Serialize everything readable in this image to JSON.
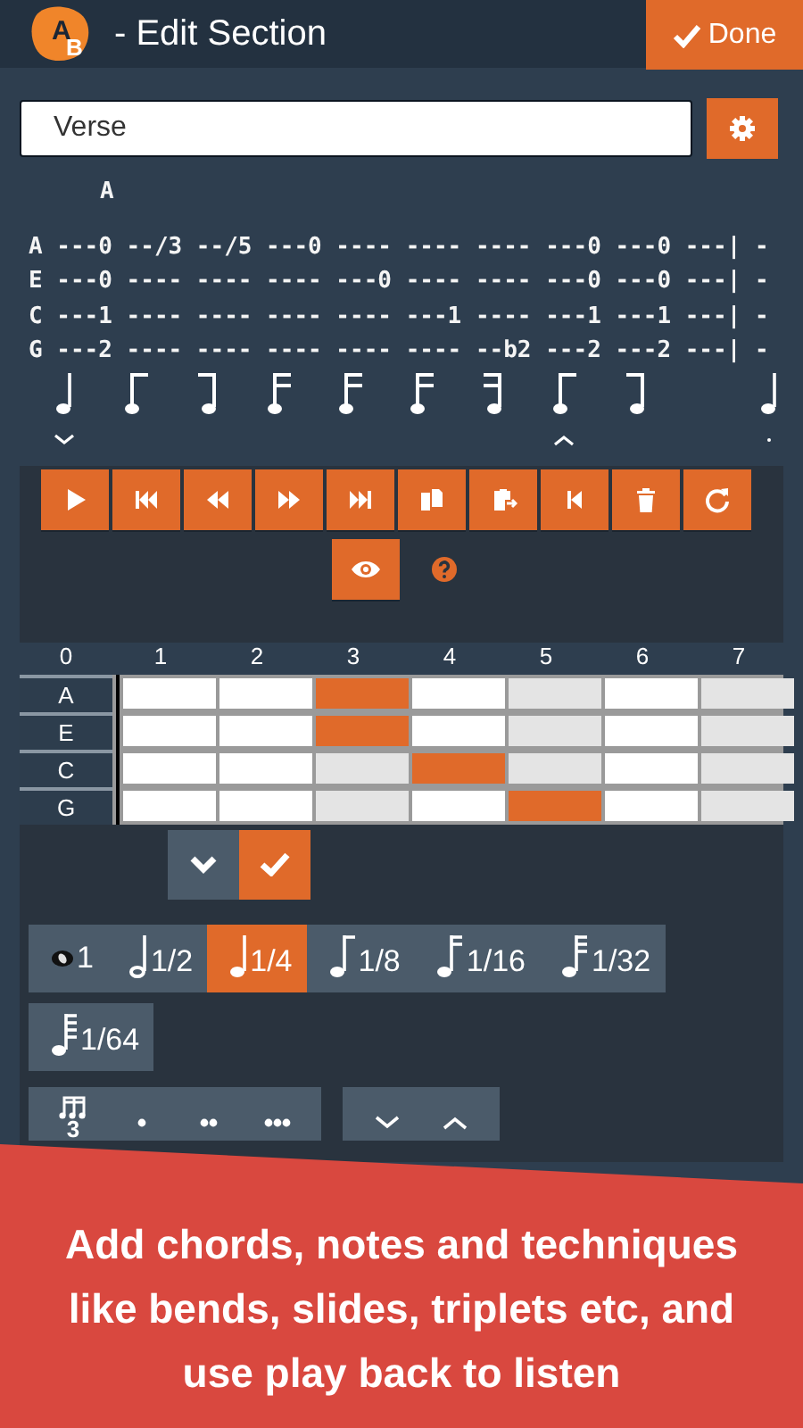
{
  "header": {
    "logo": "AB",
    "title": "- Edit Section",
    "done_button": "Done"
  },
  "section_name": {
    "value": "Verse"
  },
  "tab": {
    "chords": [
      {
        "label": "A"
      }
    ],
    "lines": [
      "A ---0 --/3 --/5 ---0 ---- ---- ---- ---0 ---0 ---| -",
      "E ---0 ---- ---- ---- ---0 ---- ---- ---0 ---0 ---| -",
      "C ---1 ---- ---- ---- ---- ---1 ---- ---1 ---1 ---| -",
      "G ---2 ---- ---- ---- ---- ---- --b2 ---2 ---2 ---| -"
    ],
    "measures": [
      {
        "notes": [
          {
            "kind": "quarter",
            "caret": {
              "kind": "down"
            }
          },
          {
            "kind": "beam1-start"
          },
          {
            "kind": "beam1-end"
          },
          {
            "kind": "beam2-start"
          },
          {
            "kind": "beam2-start"
          },
          {
            "kind": "beam2-start"
          },
          {
            "kind": "beam2-end"
          },
          {
            "kind": "beam1-start",
            "caret": {
              "kind": "up"
            }
          },
          {
            "kind": "beam1-end"
          }
        ]
      },
      {
        "notes": [
          {
            "kind": "quarter",
            "caret": {
              "kind": "dot"
            }
          }
        ]
      }
    ]
  },
  "toolbar": [
    {
      "kind": "play"
    },
    {
      "kind": "skip-start"
    },
    {
      "kind": "rewind"
    },
    {
      "kind": "fast-forward"
    },
    {
      "kind": "skip-end"
    },
    {
      "kind": "copy"
    },
    {
      "kind": "paste"
    },
    {
      "kind": "step-back"
    },
    {
      "kind": "delete"
    },
    {
      "kind": "refresh"
    }
  ],
  "toolbar_extra": [
    {
      "kind": "eye-button"
    },
    {
      "kind": "help"
    }
  ],
  "fretboard": {
    "frets": [
      "0",
      "1",
      "2",
      "3",
      "4",
      "5",
      "6",
      "7"
    ],
    "strings": [
      {
        "label": "A",
        "cells": [
          {
            "selected": false,
            "dimmed": false
          },
          {
            "selected": false,
            "dimmed": false
          },
          {
            "selected": true,
            "dimmed": false
          },
          {
            "selected": false,
            "dimmed": false
          },
          {
            "selected": false,
            "dimmed": true
          },
          {
            "selected": false,
            "dimmed": false
          },
          {
            "selected": false,
            "dimmed": true
          }
        ]
      },
      {
        "label": "E",
        "cells": [
          {
            "selected": false,
            "dimmed": false
          },
          {
            "selected": false,
            "dimmed": false
          },
          {
            "selected": true,
            "dimmed": false
          },
          {
            "selected": false,
            "dimmed": false
          },
          {
            "selected": false,
            "dimmed": true
          },
          {
            "selected": false,
            "dimmed": false
          },
          {
            "selected": false,
            "dimmed": true
          }
        ]
      },
      {
        "label": "C",
        "cells": [
          {
            "selected": false,
            "dimmed": false
          },
          {
            "selected": false,
            "dimmed": false
          },
          {
            "selected": false,
            "dimmed": true
          },
          {
            "selected": true,
            "dimmed": false
          },
          {
            "selected": false,
            "dimmed": true
          },
          {
            "selected": false,
            "dimmed": false
          },
          {
            "selected": false,
            "dimmed": true
          }
        ]
      },
      {
        "label": "G",
        "cells": [
          {
            "selected": false,
            "dimmed": false
          },
          {
            "selected": false,
            "dimmed": false
          },
          {
            "selected": false,
            "dimmed": true
          },
          {
            "selected": false,
            "dimmed": false
          },
          {
            "selected": true,
            "dimmed": false
          },
          {
            "selected": false,
            "dimmed": false
          },
          {
            "selected": false,
            "dimmed": true
          }
        ]
      }
    ]
  },
  "confirm_buttons": [
    {
      "kind": "collapse",
      "selected": false
    },
    {
      "kind": "apply",
      "selected": true
    }
  ],
  "durations": [
    {
      "label": "1",
      "kind": "whole",
      "selected": false
    },
    {
      "label": "1/2",
      "kind": "half",
      "selected": false
    },
    {
      "label": "1/4",
      "kind": "quarter",
      "selected": true
    },
    {
      "label": "1/8",
      "kind": "eighth",
      "selected": false
    },
    {
      "label": "1/16",
      "kind": "sixteenth",
      "selected": false
    },
    {
      "label": "1/32",
      "kind": "thirty-second",
      "selected": false
    },
    {
      "label": "1/64",
      "kind": "sixty-fourth",
      "selected": false
    }
  ],
  "modifiers": [
    {
      "kind": "triplet",
      "label": "3"
    },
    {
      "kind": "dot"
    },
    {
      "kind": "double-dot"
    },
    {
      "kind": "triple-dot"
    }
  ],
  "octave_buttons": [
    {
      "kind": "down"
    },
    {
      "kind": "up"
    }
  ],
  "banner": {
    "text": "Add chords, notes and techniques like bends, slides, triplets etc, and use play back to listen"
  }
}
